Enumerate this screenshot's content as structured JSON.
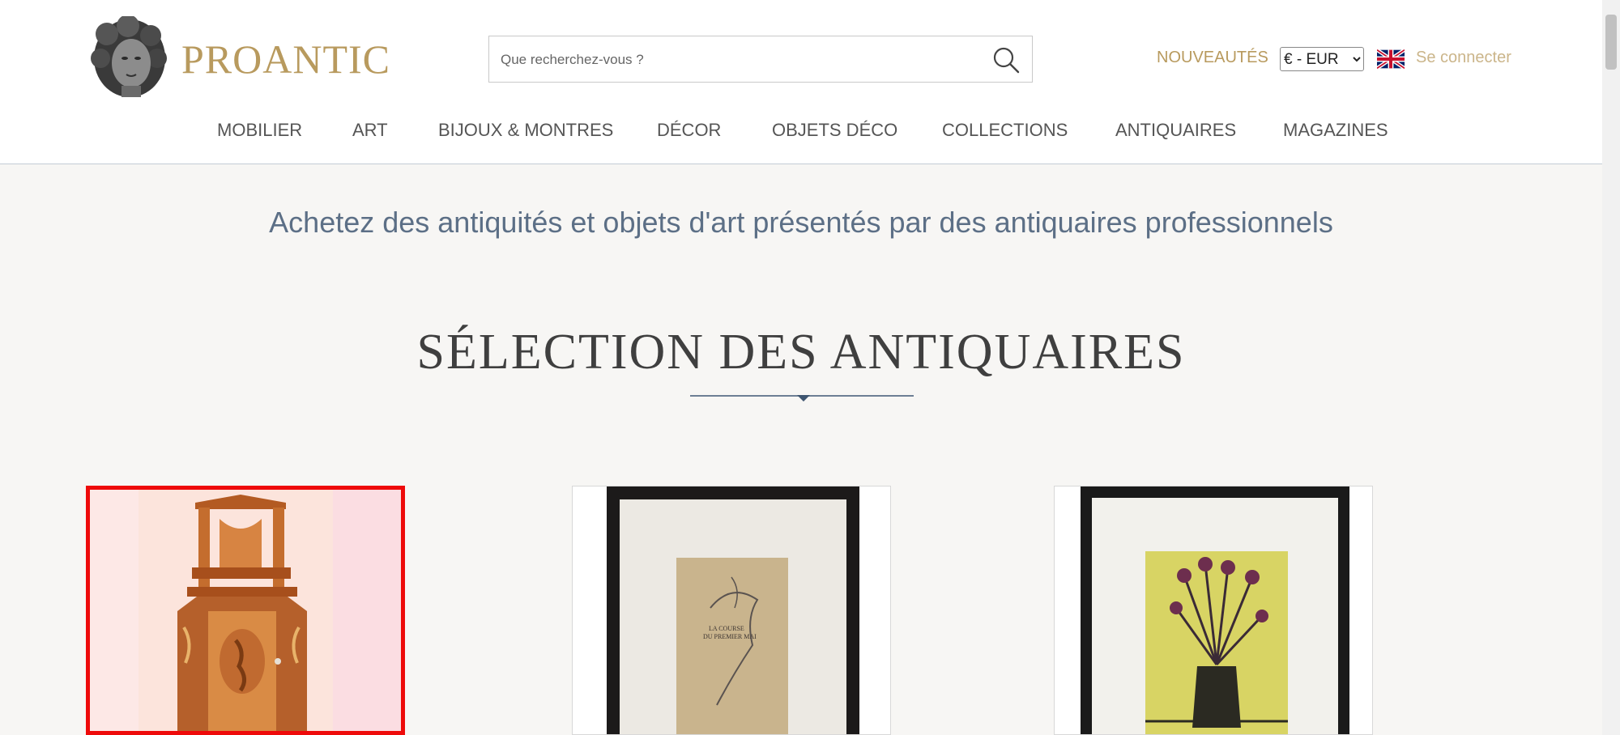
{
  "header": {
    "logo_text": "PROANTIC",
    "search_placeholder": "Que recherchez-vous ?",
    "new_label": "NOUVEAUTÉS",
    "currency_selected": "€ - EUR",
    "login_label": "Se connecter"
  },
  "nav": {
    "items": [
      {
        "label": "MOBILIER"
      },
      {
        "label": "ART"
      },
      {
        "label": "BIJOUX & MONTRES"
      },
      {
        "label": "DÉCOR"
      },
      {
        "label": "OBJETS DÉCO"
      },
      {
        "label": "COLLECTIONS"
      },
      {
        "label": "ANTIQUAIRES"
      },
      {
        "label": "MAGAZINES"
      }
    ]
  },
  "main": {
    "tagline": "Achetez des antiquités et objets d'art présentés par des antiquaires professionnels",
    "section_title": "SÉLECTION DES ANTIQUAIRES",
    "drawing_text": [
      "LA COURSE",
      "DU PREMIER MAI"
    ]
  },
  "colors": {
    "brand_gold": "#b89a5e",
    "nav_text": "#555555",
    "tagline_blue": "#5c6f86",
    "selection_red": "#ee0a0a",
    "page_bg": "#f7f6f4"
  },
  "icons": {
    "search": "search-icon",
    "flag": "uk-flag-icon",
    "logo": "bust-logo-icon"
  }
}
